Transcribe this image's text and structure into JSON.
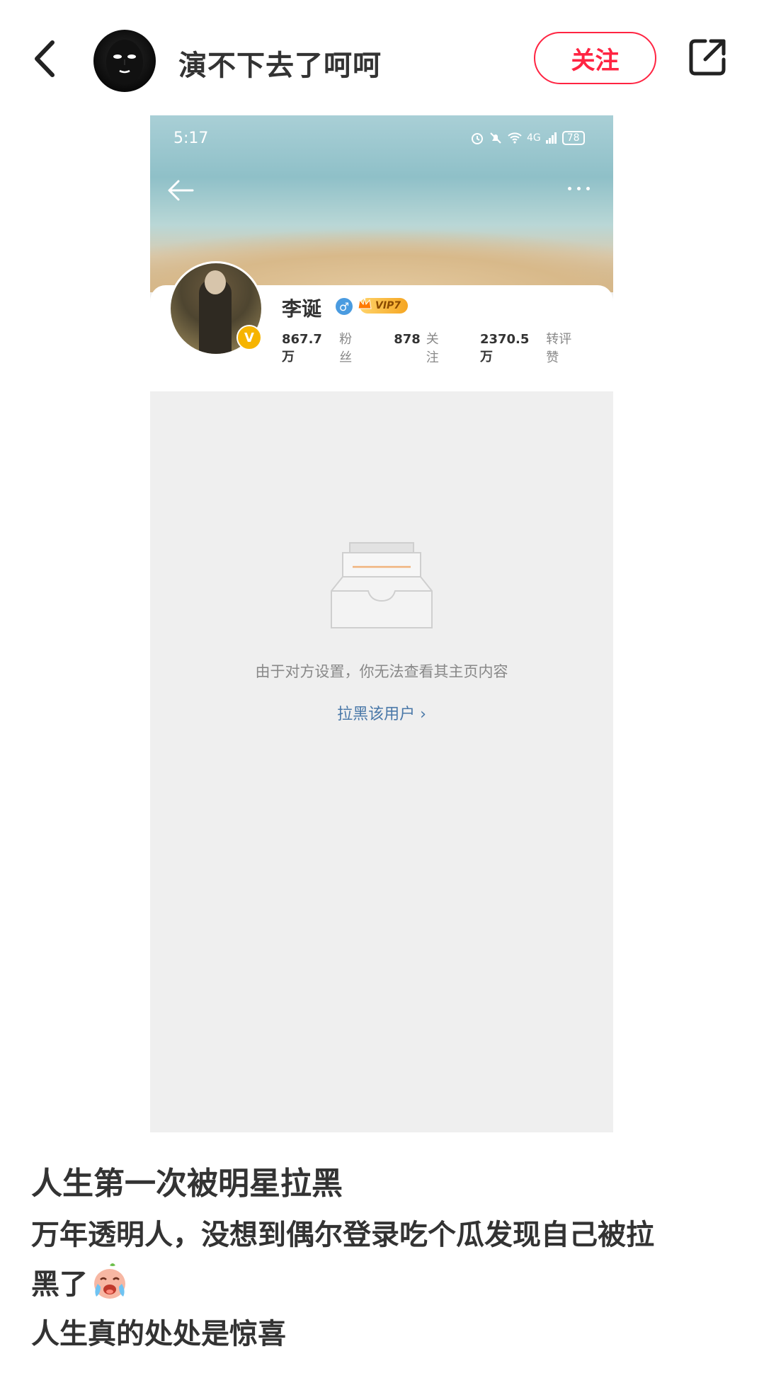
{
  "header": {
    "username": "演不下去了呵呵",
    "follow_label": "关注",
    "icons": {
      "back": "chevron-left-icon",
      "share": "share-icon"
    }
  },
  "screenshot": {
    "status_bar": {
      "time": "5:17",
      "network": "4G",
      "battery": "78"
    },
    "profile": {
      "name": "李诞",
      "gender": "♂",
      "vip_label": "VIP7",
      "verified_badge": "V",
      "stats": [
        {
          "num": "867.7万",
          "label": "粉丝"
        },
        {
          "num": "878",
          "label": "关注"
        },
        {
          "num": "2370.5万",
          "label": "转评赞"
        }
      ]
    },
    "empty_message": "由于对方设置，你无法查看其主页内容",
    "block_link": "拉黑该用户 ›"
  },
  "post": {
    "title": "人生第一次被明星拉黑",
    "line1": "万年透明人，没想到偶尔登录吃个瓜发现自己被拉",
    "line2": "黑了",
    "line3": "人生真的处处是惊喜",
    "emoji": "crying-face-emoji"
  },
  "colors": {
    "accent": "#ff2442",
    "link": "#4a78a8",
    "vip": "#f5a623"
  }
}
